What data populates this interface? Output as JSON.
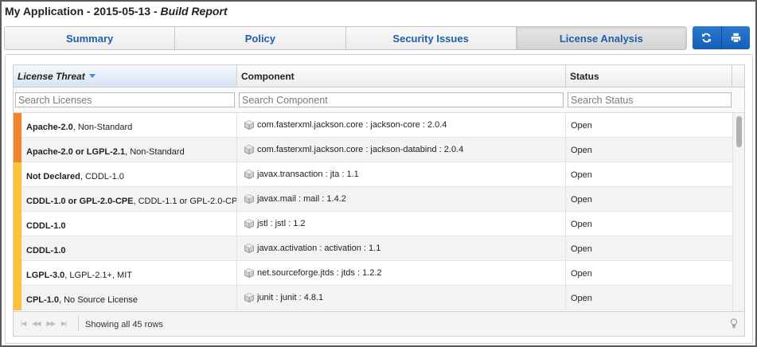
{
  "window": {
    "title_main": "My Application - 2015-05-13 - ",
    "title_sub": "Build Report"
  },
  "tabs": [
    {
      "label": "Summary",
      "active": false
    },
    {
      "label": "Policy",
      "active": false
    },
    {
      "label": "Security Issues",
      "active": false
    },
    {
      "label": "License Analysis",
      "active": true
    }
  ],
  "toolbar": {
    "refresh_icon": "refresh-icon",
    "print_icon": "print-icon",
    "accent": "#1f6cc4"
  },
  "grid": {
    "columns": [
      {
        "label": "License Threat",
        "sorted": true,
        "sort_dir": "desc"
      },
      {
        "label": "Component"
      },
      {
        "label": "Status"
      }
    ],
    "filters": [
      {
        "placeholder": "Search Licenses",
        "value": ""
      },
      {
        "placeholder": "Search Component",
        "value": ""
      },
      {
        "placeholder": "Search Status",
        "value": ""
      }
    ],
    "threat_colors": {
      "high": "#f2852b",
      "medium": "#fbc23a"
    },
    "rows": [
      {
        "threat": "high",
        "license_bold": "Apache-2.0",
        "license_rest": ", Non-Standard",
        "component": "com.fasterxml.jackson.core : jackson-core : 2.0.4",
        "status": "Open"
      },
      {
        "threat": "high",
        "license_bold": "Apache-2.0 or LGPL-2.1",
        "license_rest": ", Non-Standard",
        "component": "com.fasterxml.jackson.core : jackson-databind : 2.0.4",
        "status": "Open"
      },
      {
        "threat": "medium",
        "license_bold": "Not Declared",
        "license_rest": ", CDDL-1.0",
        "component": "javax.transaction : jta : 1.1",
        "status": "Open"
      },
      {
        "threat": "medium",
        "license_bold": "CDDL-1.0 or GPL-2.0-CPE",
        "license_rest": ", CDDL-1.1 or GPL-2.0-CP",
        "component": "javax.mail : mail : 1.4.2",
        "status": "Open"
      },
      {
        "threat": "medium",
        "license_bold": "CDDL-1.0",
        "license_rest": "",
        "component": "jstl : jstl : 1.2",
        "status": "Open"
      },
      {
        "threat": "medium",
        "license_bold": "CDDL-1.0",
        "license_rest": "",
        "component": "javax.activation : activation : 1.1",
        "status": "Open"
      },
      {
        "threat": "medium",
        "license_bold": "LGPL-3.0",
        "license_rest": ", LGPL-2.1+, MIT",
        "component": "net.sourceforge.jtds : jtds : 1.2.2",
        "status": "Open"
      },
      {
        "threat": "medium",
        "license_bold": "CPL-1.0",
        "license_rest": ", No Source License",
        "component": "junit : junit : 4.8.1",
        "status": "Open"
      }
    ]
  },
  "footer": {
    "pager_icons": [
      "first-page-icon",
      "prev-page-icon",
      "next-page-icon",
      "last-page-icon"
    ],
    "row_count": "Showing all 45 rows",
    "hint_icon": "lightbulb-icon"
  }
}
